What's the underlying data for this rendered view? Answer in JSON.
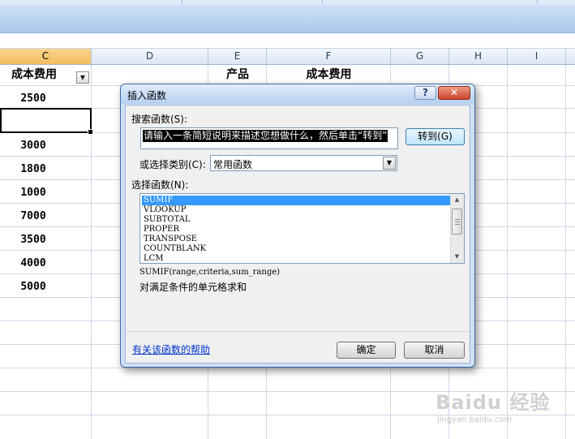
{
  "spreadsheet": {
    "columns": [
      {
        "name": "C",
        "selected": true
      },
      {
        "name": "D",
        "selected": false
      },
      {
        "name": "E",
        "selected": false
      },
      {
        "name": "F",
        "selected": false
      },
      {
        "name": "G",
        "selected": false
      },
      {
        "name": "H",
        "selected": false
      },
      {
        "name": "I",
        "selected": false
      }
    ],
    "header_cells": {
      "c": "成本费用",
      "e": "产品",
      "f": "成本费用"
    },
    "column_c_values": [
      "2500",
      "",
      "3000",
      "1800",
      "1000",
      "7000",
      "3500",
      "4000",
      "5000"
    ]
  },
  "dialog": {
    "title": "插入函数",
    "help_button": "?",
    "close_button": "✕",
    "search_label": "搜索函数(S):",
    "search_value": "请输入一条简短说明来描述您想做什么，然后单击“转到”",
    "goto_button": "转到(G)",
    "category_label": "或选择类别(C):",
    "category_value": "常用函数",
    "function_list_label": "选择函数(N):",
    "functions": [
      "SUMIF",
      "VLOOKUP",
      "SUBTOTAL",
      "PROPER",
      "TRANSPOSE",
      "COUNTBLANK",
      "LCM"
    ],
    "selected_function": "SUMIF",
    "syntax": "SUMIF(range,criteria,sum_range)",
    "description": "对满足条件的单元格求和",
    "help_link": "有关该函数的帮助",
    "ok_button": "确定",
    "cancel_button": "取消"
  },
  "watermark": {
    "logo": "Baidu 经验",
    "url": "jingyan.baidu.com"
  }
}
